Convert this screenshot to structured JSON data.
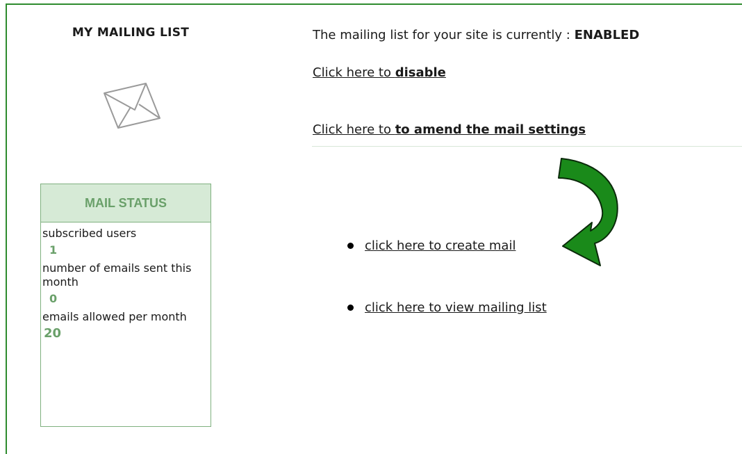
{
  "sidebar": {
    "title": "MY MAILING LIST",
    "envelope_icon": "envelope-icon",
    "status_box": {
      "header": "MAIL STATUS",
      "stats": [
        {
          "label": "subscribed users",
          "value": "1"
        },
        {
          "label": "number of emails sent this month",
          "value": "0"
        },
        {
          "label": "emails allowed per month",
          "value": "20"
        }
      ]
    }
  },
  "main": {
    "status_prefix": "The mailing list for your site is currently : ",
    "status_value": "ENABLED",
    "disable_link": {
      "prefix": "Click here to ",
      "bold": "disable"
    },
    "settings_link": {
      "prefix": "Click here to ",
      "bold": "to amend the mail settings"
    },
    "actions": [
      {
        "label": "click here to create mail"
      },
      {
        "label": "click here to view mailing list"
      }
    ],
    "pointer_icon": "curved-arrow-icon"
  },
  "colors": {
    "frame": "#2e8b2e",
    "status_header_bg": "#d6ead6",
    "status_accent": "#6aa06a",
    "arrow_fill": "#1a8a1a"
  }
}
